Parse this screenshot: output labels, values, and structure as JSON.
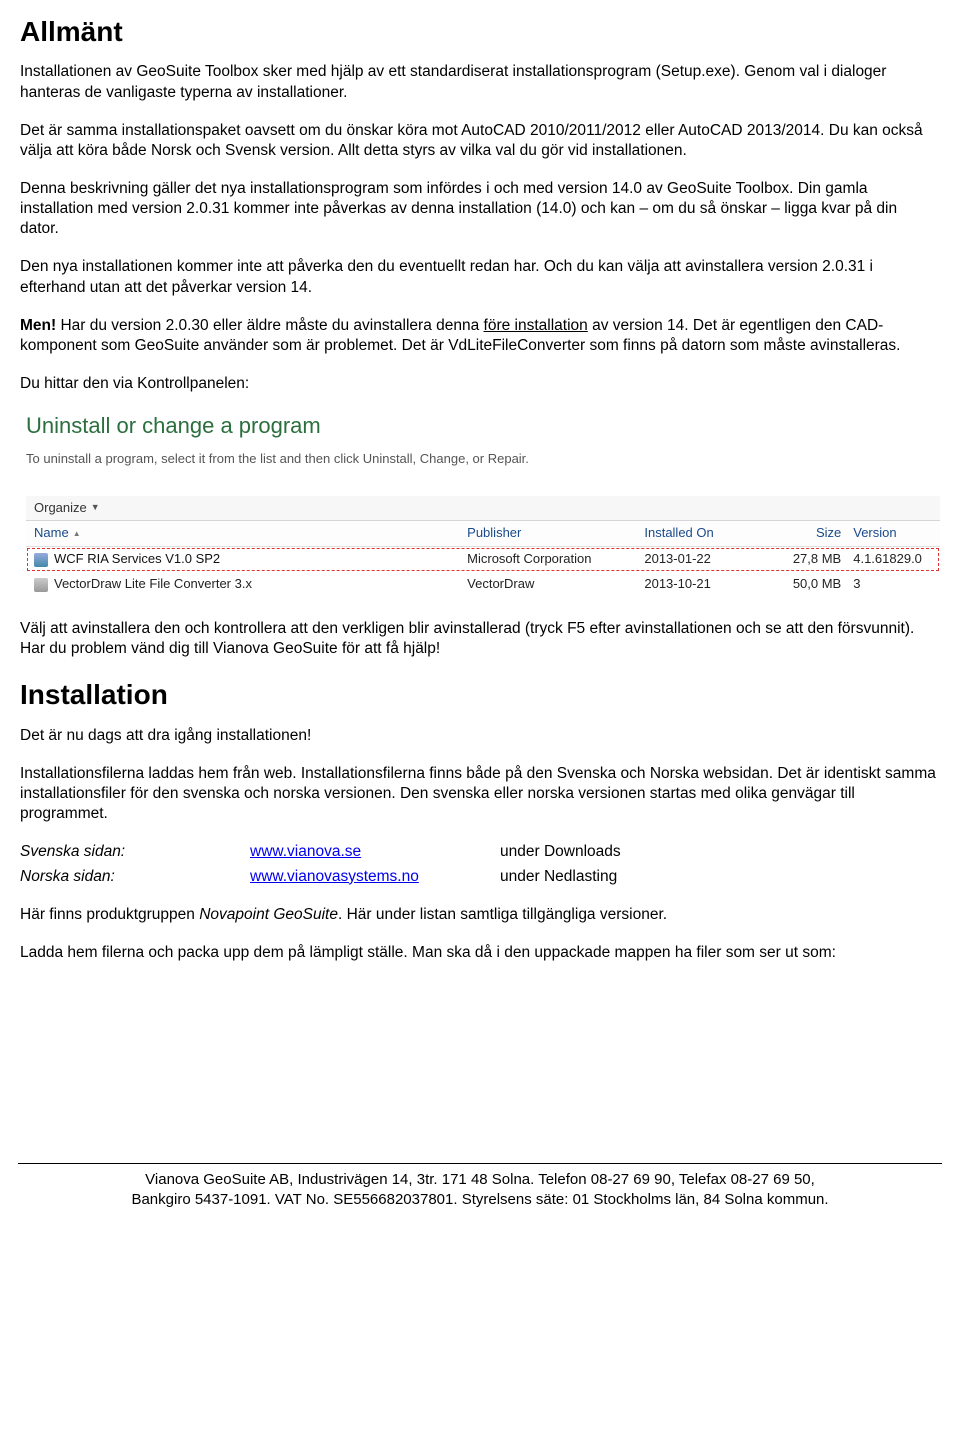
{
  "h1_allmant": "Allmänt",
  "p1": "Installationen av GeoSuite Toolbox sker med hjälp av ett standardiserat installationsprogram (Setup.exe). Genom val i dialoger hanteras de vanligaste typerna av installationer.",
  "p2": "Det är samma installationspaket oavsett om du önskar köra mot AutoCAD 2010/2011/2012 eller AutoCAD 2013/2014. Du kan också välja att köra både Norsk och Svensk version. Allt detta styrs av vilka val du gör vid installationen.",
  "p3": "Denna beskrivning gäller det nya installationsprogram som infördes i och med version 14.0 av GeoSuite Toolbox. Din gamla installation med version 2.0.31 kommer inte påverkas av denna installation (14.0) och kan – om du så önskar – ligga kvar på din dator.",
  "p4": "Den nya installationen kommer inte att påverka den du eventuellt redan har. Och du kan välja att avinstallera version 2.0.31 i efterhand utan att det påverkar version 14.",
  "p5_bold": "Men!",
  "p5_a": " Har du version 2.0.30 eller äldre måste du avinstallera denna ",
  "p5_u": "före installation",
  "p5_b": " av version 14. Det är egentligen den CAD-komponent som GeoSuite använder som är problemet. Det är VdLiteFileConverter som finns på datorn som måste avinstalleras.",
  "p6": "Du hittar den via Kontrollpanelen:",
  "cp": {
    "title": "Uninstall or change a program",
    "sub": "To uninstall a program, select it from the list and then click Uninstall, Change, or Repair.",
    "organize": "Organize",
    "cols": {
      "name": "Name",
      "publisher": "Publisher",
      "installed": "Installed On",
      "size": "Size",
      "version": "Version"
    },
    "rows": [
      {
        "name": "WCF RIA Services V1.0 SP2",
        "publisher": "Microsoft Corporation",
        "installed": "2013-01-22",
        "size": "27,8 MB",
        "version": "4.1.61829.0",
        "selected": true
      },
      {
        "name": "VectorDraw Lite File Converter 3.x",
        "publisher": "VectorDraw",
        "installed": "2013-10-21",
        "size": "50,0 MB",
        "version": "3",
        "selected": false
      }
    ]
  },
  "p7": "Välj att avinstallera den och kontrollera att den verkligen blir avinstallerad (tryck F5 efter avinstallationen och se att den försvunnit). Har du problem vänd dig till Vianova GeoSuite för att få hjälp!",
  "h1_install": "Installation",
  "p8": "Det är nu dags att dra igång installationen!",
  "p9": "Installationsfilerna laddas hem från web. Installationsfilerna finns både på den Svenska och Norska websidan. Det är identiskt samma installationsfiler för den svenska och norska versionen. Den svenska eller norska versionen startas med olika genvägar till programmet.",
  "sites": [
    {
      "label": "Svenska sidan:",
      "link": "www.vianova.se",
      "desc": "under Downloads"
    },
    {
      "label": "Norska sidan:",
      "link": "www.vianovasystems.no",
      "desc": "under Nedlasting"
    }
  ],
  "p10_a": "Här finns produktgruppen ",
  "p10_i": "Novapoint GeoSuite",
  "p10_b": ". Här under listan samtliga tillgängliga versioner.",
  "p11": "Ladda hem filerna och packa upp dem på lämpligt ställe. Man ska då i den uppackade mappen ha filer som ser ut som:",
  "footer1": "Vianova GeoSuite AB, Industrivägen 14, 3tr. 171 48 Solna. Telefon 08-27 69 90, Telefax 08-27 69 50,",
  "footer2": "Bankgiro 5437-1091. VAT No. SE556682037801. Styrelsens säte: 01 Stockholms län, 84 Solna kommun."
}
